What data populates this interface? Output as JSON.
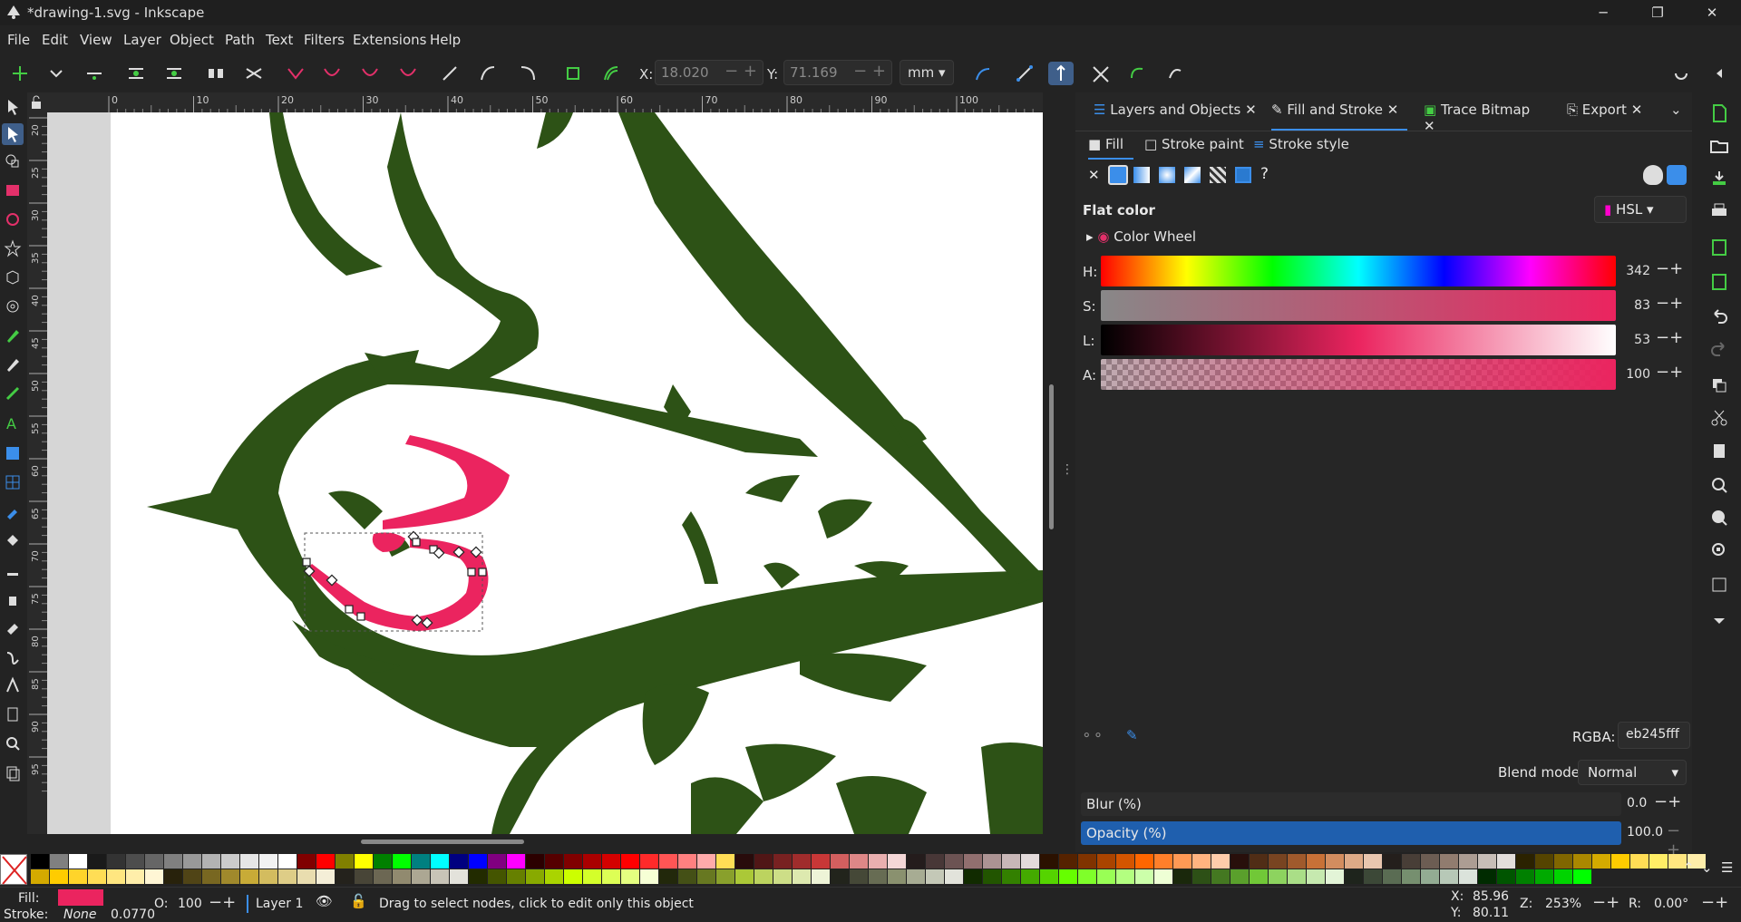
{
  "window": {
    "title": "*drawing-1.svg - Inkscape",
    "minimize": "─",
    "maximize": "❐",
    "close": "✕"
  },
  "menu": [
    "File",
    "Edit",
    "View",
    "Layer",
    "Object",
    "Path",
    "Text",
    "Filters",
    "Extensions",
    "Help"
  ],
  "toolbar": {
    "x_label": "X:",
    "x_value": "18.020",
    "y_label": "Y:",
    "y_value": "71.169",
    "unit": "mm"
  },
  "ruler": {
    "h_ticks": [
      "0",
      "10",
      "20",
      "30",
      "40",
      "50",
      "60",
      "70",
      "80",
      "90",
      "100"
    ],
    "v_ticks": [
      "20",
      "25",
      "30",
      "35",
      "40",
      "45",
      "50",
      "55",
      "60",
      "65",
      "70",
      "75",
      "80",
      "85",
      "90",
      "95"
    ]
  },
  "panel": {
    "tabs": [
      "Layers and Objects",
      "Fill and Stroke",
      "Trace Bitmap",
      "Export"
    ],
    "subtabs": [
      "Fill",
      "Stroke paint",
      "Stroke style"
    ],
    "flat_color": "Flat color",
    "color_mode": "HSL",
    "color_wheel": "Color Wheel",
    "h_label": "H:",
    "h_value": "342",
    "s_label": "S:",
    "s_value": "83",
    "l_label": "L:",
    "l_value": "53",
    "a_label": "A:",
    "a_value": "100",
    "rgba_label": "RGBA:",
    "rgba_value": "eb245fff",
    "blend_label": "Blend mode:",
    "blend_value": "Normal",
    "blur_label": "Blur (%)",
    "blur_value": "0.0",
    "opacity_label": "Opacity (%)",
    "opacity_value": "100.0",
    "unknown_icon": "?"
  },
  "colors": {
    "accent": "#3b8eea",
    "fill": "#eb245f",
    "shape": "#2d5216",
    "selection": "#3f5f8a"
  },
  "status": {
    "fill_label": "Fill:",
    "stroke_label": "Stroke:",
    "stroke_value": "None",
    "stroke_width": "0.0770",
    "o_label": "O:",
    "o_value": "100",
    "layer": "Layer 1",
    "message": "Drag to select nodes, click to edit only this object",
    "cx_label": "X:",
    "cx_value": "85.96",
    "cy_label": "Y:",
    "cy_value": "80.11",
    "z_label": "Z:",
    "z_value": "253%",
    "r_label": "R:",
    "r_value": "0.00°"
  }
}
